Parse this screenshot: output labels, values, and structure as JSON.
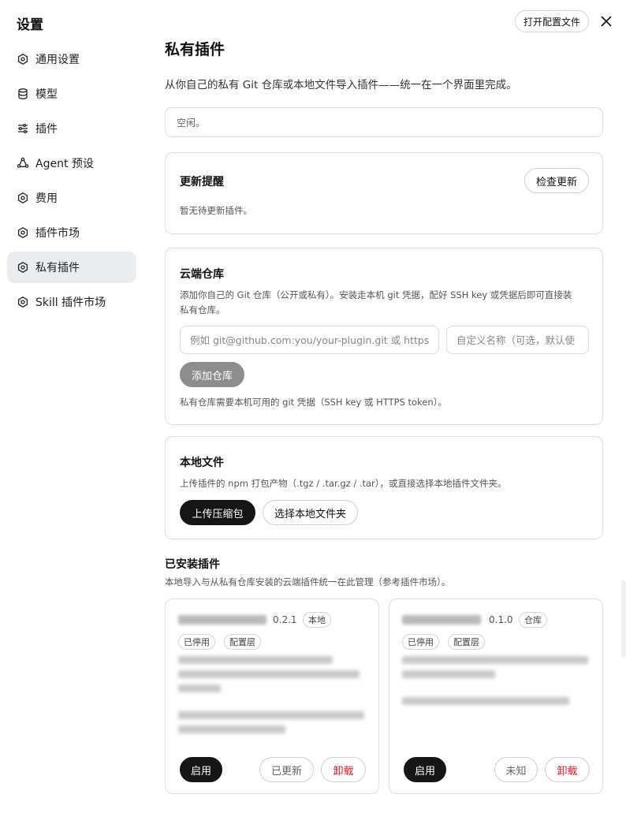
{
  "app": {
    "title": "设置",
    "open_config_label": "打开配置文件"
  },
  "sidebar": {
    "items": [
      {
        "label": "通用设置",
        "icon": "gear-icon"
      },
      {
        "label": "模型",
        "icon": "database-icon"
      },
      {
        "label": "插件",
        "icon": "sliders-icon"
      },
      {
        "label": "Agent 预设",
        "icon": "agent-icon"
      },
      {
        "label": "费用",
        "icon": "gear-icon"
      },
      {
        "label": "插件市场",
        "icon": "gear-icon"
      },
      {
        "label": "私有插件",
        "icon": "gear-icon",
        "active": true
      },
      {
        "label": "Skill 插件市场",
        "icon": "gear-icon"
      }
    ]
  },
  "main": {
    "title": "私有插件",
    "description": "从你自己的私有 Git 仓库或本地文件导入插件——统一在一个界面里完成。",
    "status": "空闲。",
    "updates": {
      "title": "更新提醒",
      "check_label": "检查更新",
      "empty_text": "暂无待更新插件。"
    },
    "cloud": {
      "title": "云端仓库",
      "desc_line1": "添加你自己的 Git 仓库（公开或私有）。安装走本机 git 凭据，配好 SSH key 或凭据后即可直接装",
      "desc_line2": "私有仓库。",
      "url_placeholder": "例如 git@github.com:you/your-plugin.git 或 https:/",
      "name_placeholder": "自定义名称（可选，默认使",
      "add_label": "添加仓库",
      "note": "私有仓库需要本机可用的 git 凭据（SSH key 或 HTTPS token）。"
    },
    "local": {
      "title": "本地文件",
      "desc": "上传插件的 npm 打包产物（.tgz / .tar.gz / .tar），或直接选择本地插件文件夹。",
      "upload_label": "上传压缩包",
      "choose_label": "选择本地文件夹"
    },
    "installed": {
      "title": "已安装插件",
      "desc": "本地导入与从私有仓库安装的云端插件统一在此管理（参考插件市场）。",
      "plugins": [
        {
          "version": "0.2.1",
          "source_tag": "本地",
          "tags": [
            "已停用",
            "配置层"
          ],
          "enable_label": "启用",
          "status_label": "已更新",
          "uninstall_label": "卸载"
        },
        {
          "version": "0.1.0",
          "source_tag": "仓库",
          "tags": [
            "已停用",
            "配置层"
          ],
          "enable_label": "启用",
          "status_label": "未知",
          "uninstall_label": "卸载"
        }
      ]
    }
  },
  "colors": {
    "accent_dark": "#161616",
    "danger": "#d42a2a",
    "active_nav": "#e9ecf1"
  }
}
